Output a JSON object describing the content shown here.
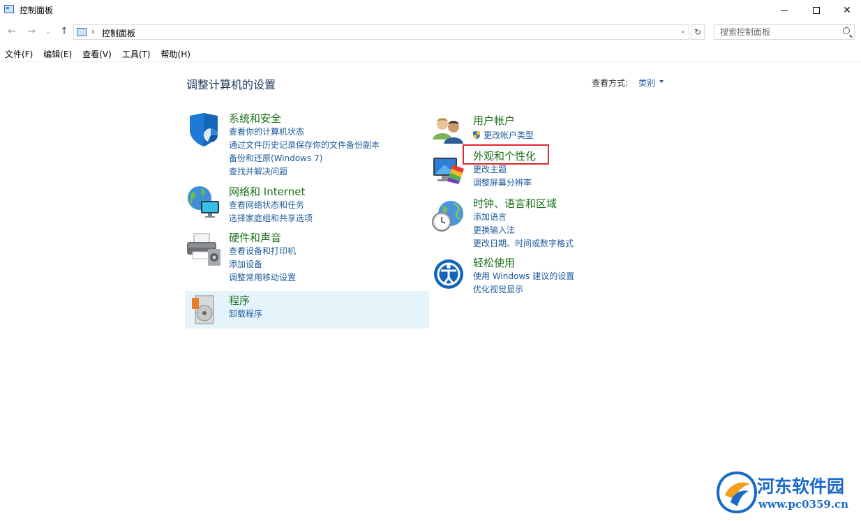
{
  "window": {
    "title": "控制面板",
    "minimize_glyph": "—",
    "close_glyph": "✕"
  },
  "nav": {
    "back_glyph": "←",
    "forward_glyph": "→",
    "recent_glyph": "⌄",
    "up_glyph": "↑",
    "separator": "›",
    "breadcrumb": "控制面板",
    "dropdown_glyph": "⌄",
    "refresh_glyph": "↻",
    "search_placeholder": "搜索控制面板"
  },
  "menu": [
    "文件(F)",
    "编辑(E)",
    "查看(V)",
    "工具(T)",
    "帮助(H)"
  ],
  "main": {
    "heading": "调整计算机的设置",
    "view_by_label": "查看方式:",
    "view_by_value": "类别"
  },
  "categories": {
    "system": {
      "title": "系统和安全",
      "links": [
        "查看你的计算机状态",
        "通过文件历史记录保存你的文件备份副本",
        "备份和还原(Windows 7)",
        "查找并解决问题"
      ]
    },
    "network": {
      "title": "网络和 Internet",
      "links": [
        "查看网络状态和任务",
        "选择家庭组和共享选项"
      ]
    },
    "hardware": {
      "title": "硬件和声音",
      "links": [
        "查看设备和打印机",
        "添加设备",
        "调整常用移动设置"
      ]
    },
    "programs": {
      "title": "程序",
      "links": [
        "卸载程序"
      ]
    },
    "accounts": {
      "title": "用户帐户",
      "links": [
        "更改帐户类型"
      ]
    },
    "appearance": {
      "title": "外观和个性化",
      "links": [
        "更改主题",
        "调整屏幕分辨率"
      ]
    },
    "clock": {
      "title": "时钟、语言和区域",
      "links": [
        "添加语言",
        "更换输入法",
        "更改日期、时间或数字格式"
      ]
    },
    "ease": {
      "title": "轻松使用",
      "links": [
        "使用 Windows 建议的设置",
        "优化视觉显示"
      ]
    }
  },
  "watermark": {
    "title": "河东软件园",
    "url": "www.pc0359.cn"
  },
  "colors": {
    "category_title": "#1a6f1a",
    "link": "#1e5b9a",
    "highlight": "#e5f3fb",
    "annotation_box": "#e0262b",
    "watermark": "#1b6ac9"
  }
}
